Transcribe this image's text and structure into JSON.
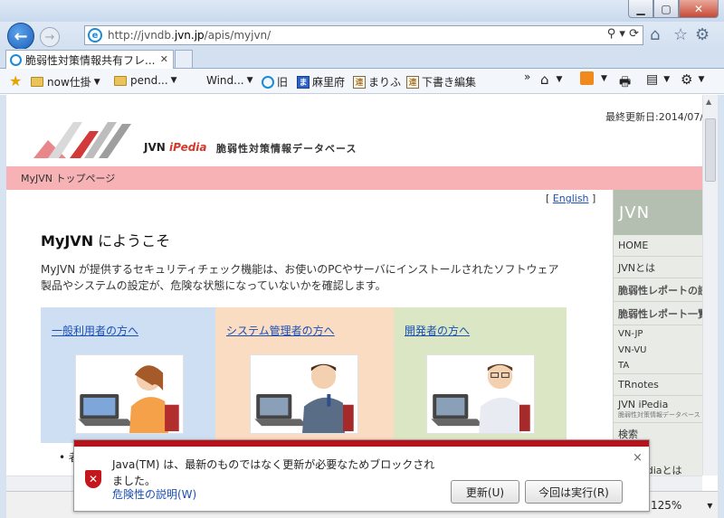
{
  "browser": {
    "url_prefix": "http://jvndb.",
    "url_domain": "jvn.jp",
    "url_suffix": "/apis/myjvn/",
    "tab_title": "脆弱性対策情報共有フレ...",
    "favorites": [
      {
        "label": "now仕掛",
        "type": "folder"
      },
      {
        "label": "pend...",
        "type": "folder"
      },
      {
        "label": "Wind...",
        "type": "text"
      },
      {
        "label": "旧",
        "type": "ie"
      },
      {
        "label": "麻里府",
        "type": "page-blue",
        "icon": "ま"
      },
      {
        "label": "まりふ",
        "type": "page",
        "icon": "連"
      },
      {
        "label": "下書き編集",
        "type": "page",
        "icon": "連"
      }
    ],
    "more_chevron": "»",
    "zoom": "125%"
  },
  "page": {
    "last_update": "最終更新日:2014/07/",
    "logo_text_jvn": "JVN ",
    "logo_text_ipedia": "iPedia",
    "logo_subtitle": "脆弱性対策情報データベース",
    "breadcrumb": "MyJVN トップページ",
    "lang_open": "[ ",
    "lang_link": "English",
    "lang_close": " ]",
    "welcome_bold": "MyJVN",
    "welcome_rest": " にようこそ",
    "intro": "MyJVN が提供するセキュリティチェック機能は、お使いのPCやサーバにインストールされたソフトウェア製品やシステムの設定が、危険な状態になっていないかを確認します。",
    "cards": [
      {
        "label": "一般利用者の方へ"
      },
      {
        "label": "システム管理者の方へ"
      },
      {
        "label": "開発者の方へ"
      }
    ],
    "bullet": "• ",
    "bullet_text": "者"
  },
  "sidebar": {
    "header": "JVN",
    "items": [
      {
        "label": "HOME"
      },
      {
        "label": "JVNとは"
      },
      {
        "label": "脆弱性レポートの読み"
      },
      {
        "label": "脆弱性レポート一覧"
      },
      {
        "label": "VN-JP"
      },
      {
        "label": "VN-VU"
      },
      {
        "label": "TA"
      },
      {
        "label": "TRnotes"
      },
      {
        "label": "JVN iPedia"
      },
      {
        "label": "脆弱性対策情報データベース"
      },
      {
        "label": "検索"
      },
      {
        "label": "ediaとは"
      }
    ]
  },
  "notification": {
    "message": "Java(TM) は、最新のものではなく更新が必要なためブロックされました。",
    "risk_link": "危険性の説明(W)",
    "update_button": "更新(U)",
    "run_button": "今回は実行(R)",
    "close": "×"
  },
  "colors": {
    "pink_bar": "#f6b2b4",
    "card_blue": "#cfdff3",
    "card_orange": "#f9dcc2",
    "card_green": "#dbe6c4",
    "notify_red": "#b5121b",
    "link": "#1a4fb5"
  }
}
